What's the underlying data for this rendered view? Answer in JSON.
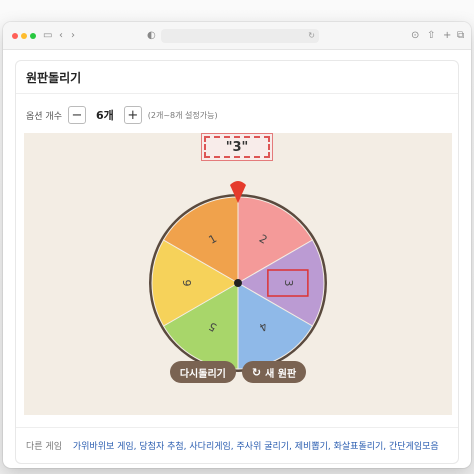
{
  "page": {
    "title": "원판돌리기"
  },
  "options": {
    "label": "옵션 개수",
    "minus": "−",
    "count": "6개",
    "plus": "+",
    "hint": "(2개~8개 설정가능)"
  },
  "result": {
    "text": "\"3\""
  },
  "wheel": {
    "segments": [
      {
        "label": "2",
        "color": "#f49a99"
      },
      {
        "label": "3",
        "color": "#bb9bd3"
      },
      {
        "label": "4",
        "color": "#8fb9e8"
      },
      {
        "label": "5",
        "color": "#a8d66a"
      },
      {
        "label": "6",
        "color": "#f6d25a"
      },
      {
        "label": "1",
        "color": "#f0a24c"
      }
    ],
    "rim_color": "#5a4a3e",
    "pointer_color": "#e53b2c"
  },
  "buttons": {
    "respin": "다시돌리기",
    "new_wheel": "새 원판",
    "new_icon": "refresh-icon"
  },
  "footer": {
    "label": "다른 게임",
    "links": "가위바위보 게임, 당첨자 추첨, 사다리게임, 주사위 굴리기, 제비뽑기, 화살표돌리기, 간단게임모음"
  }
}
